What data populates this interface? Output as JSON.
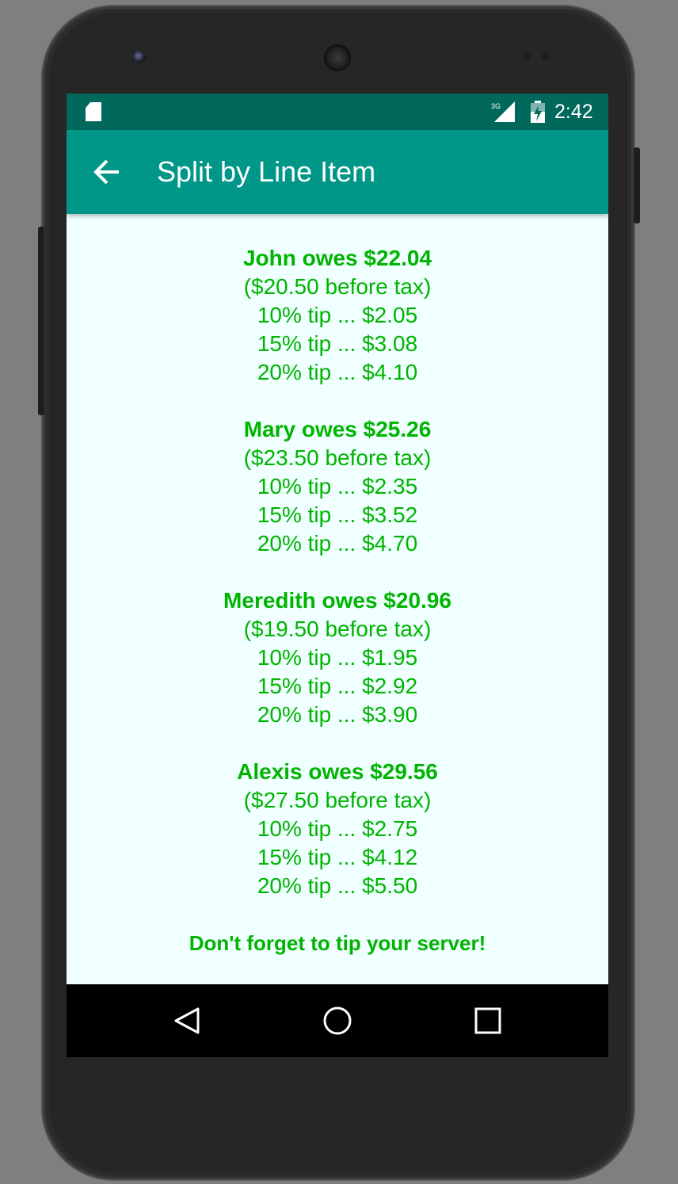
{
  "status_bar": {
    "time": "2:42",
    "network_label": "3G",
    "icons": [
      "sd-card-icon",
      "signal-icon",
      "battery-icon"
    ]
  },
  "app_bar": {
    "title": "Split by Line Item",
    "back_icon": "arrow-back-icon"
  },
  "people": [
    {
      "owes": "John owes $22.04",
      "before_tax": "($20.50 before tax)",
      "tips": [
        "10% tip ... $2.05",
        "15% tip ... $3.08",
        "20% tip ... $4.10"
      ]
    },
    {
      "owes": "Mary owes $25.26",
      "before_tax": "($23.50 before tax)",
      "tips": [
        "10% tip ... $2.35",
        "15% tip ... $3.52",
        "20% tip ... $4.70"
      ]
    },
    {
      "owes": "Meredith owes $20.96",
      "before_tax": "($19.50 before tax)",
      "tips": [
        "10% tip ... $1.95",
        "15% tip ... $2.92",
        "20% tip ... $3.90"
      ]
    },
    {
      "owes": "Alexis owes $29.56",
      "before_tax": "($27.50 before tax)",
      "tips": [
        "10% tip ... $2.75",
        "15% tip ... $4.12",
        "20% tip ... $5.50"
      ]
    }
  ],
  "reminder": "Don't forget to tip your server!",
  "nav_bar": {
    "buttons": [
      "back-triangle-icon",
      "home-circle-icon",
      "recents-square-icon"
    ]
  },
  "colors": {
    "status_bar": "#00695c",
    "app_bar": "#009688",
    "background": "#f0ffff",
    "text_green": "#00b400"
  }
}
